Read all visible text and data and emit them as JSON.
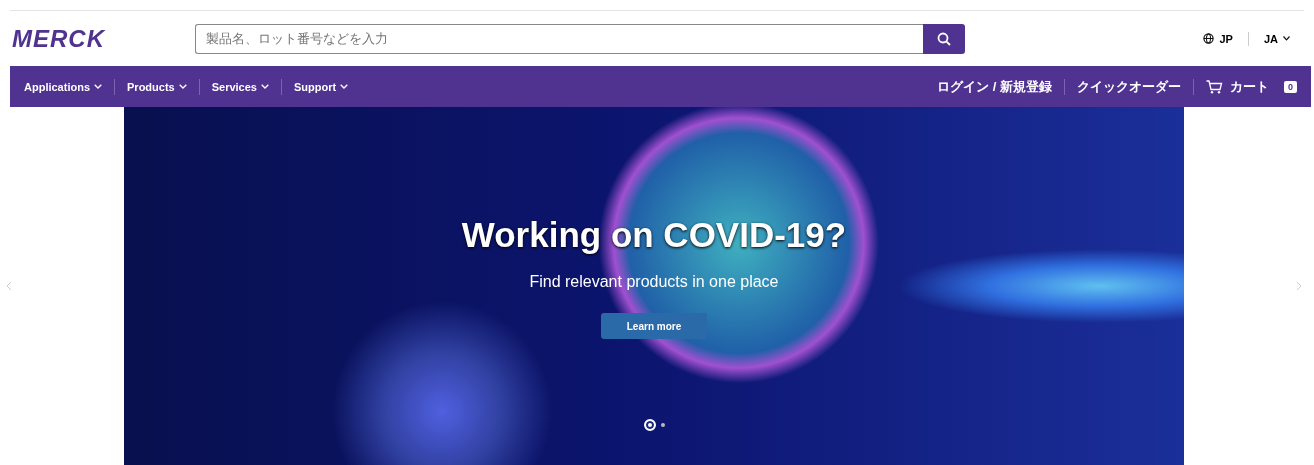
{
  "logo": "MERCK",
  "search": {
    "placeholder": "製品名、ロット番号などを入力"
  },
  "country": "JP",
  "language": "JA",
  "nav": [
    {
      "label": "Applications"
    },
    {
      "label": "Products"
    },
    {
      "label": "Services"
    },
    {
      "label": "Support"
    }
  ],
  "account_links": [
    {
      "label": "ログイン / 新規登録"
    },
    {
      "label": "クイックオーダー"
    }
  ],
  "cart": {
    "label": "カート",
    "count": "0"
  },
  "hero": {
    "title": "Working on COVID-19?",
    "subtitle": "Find relevant products in one place",
    "button": "Learn more",
    "slides": [
      {
        "selected": true
      },
      {
        "selected": false
      }
    ]
  }
}
